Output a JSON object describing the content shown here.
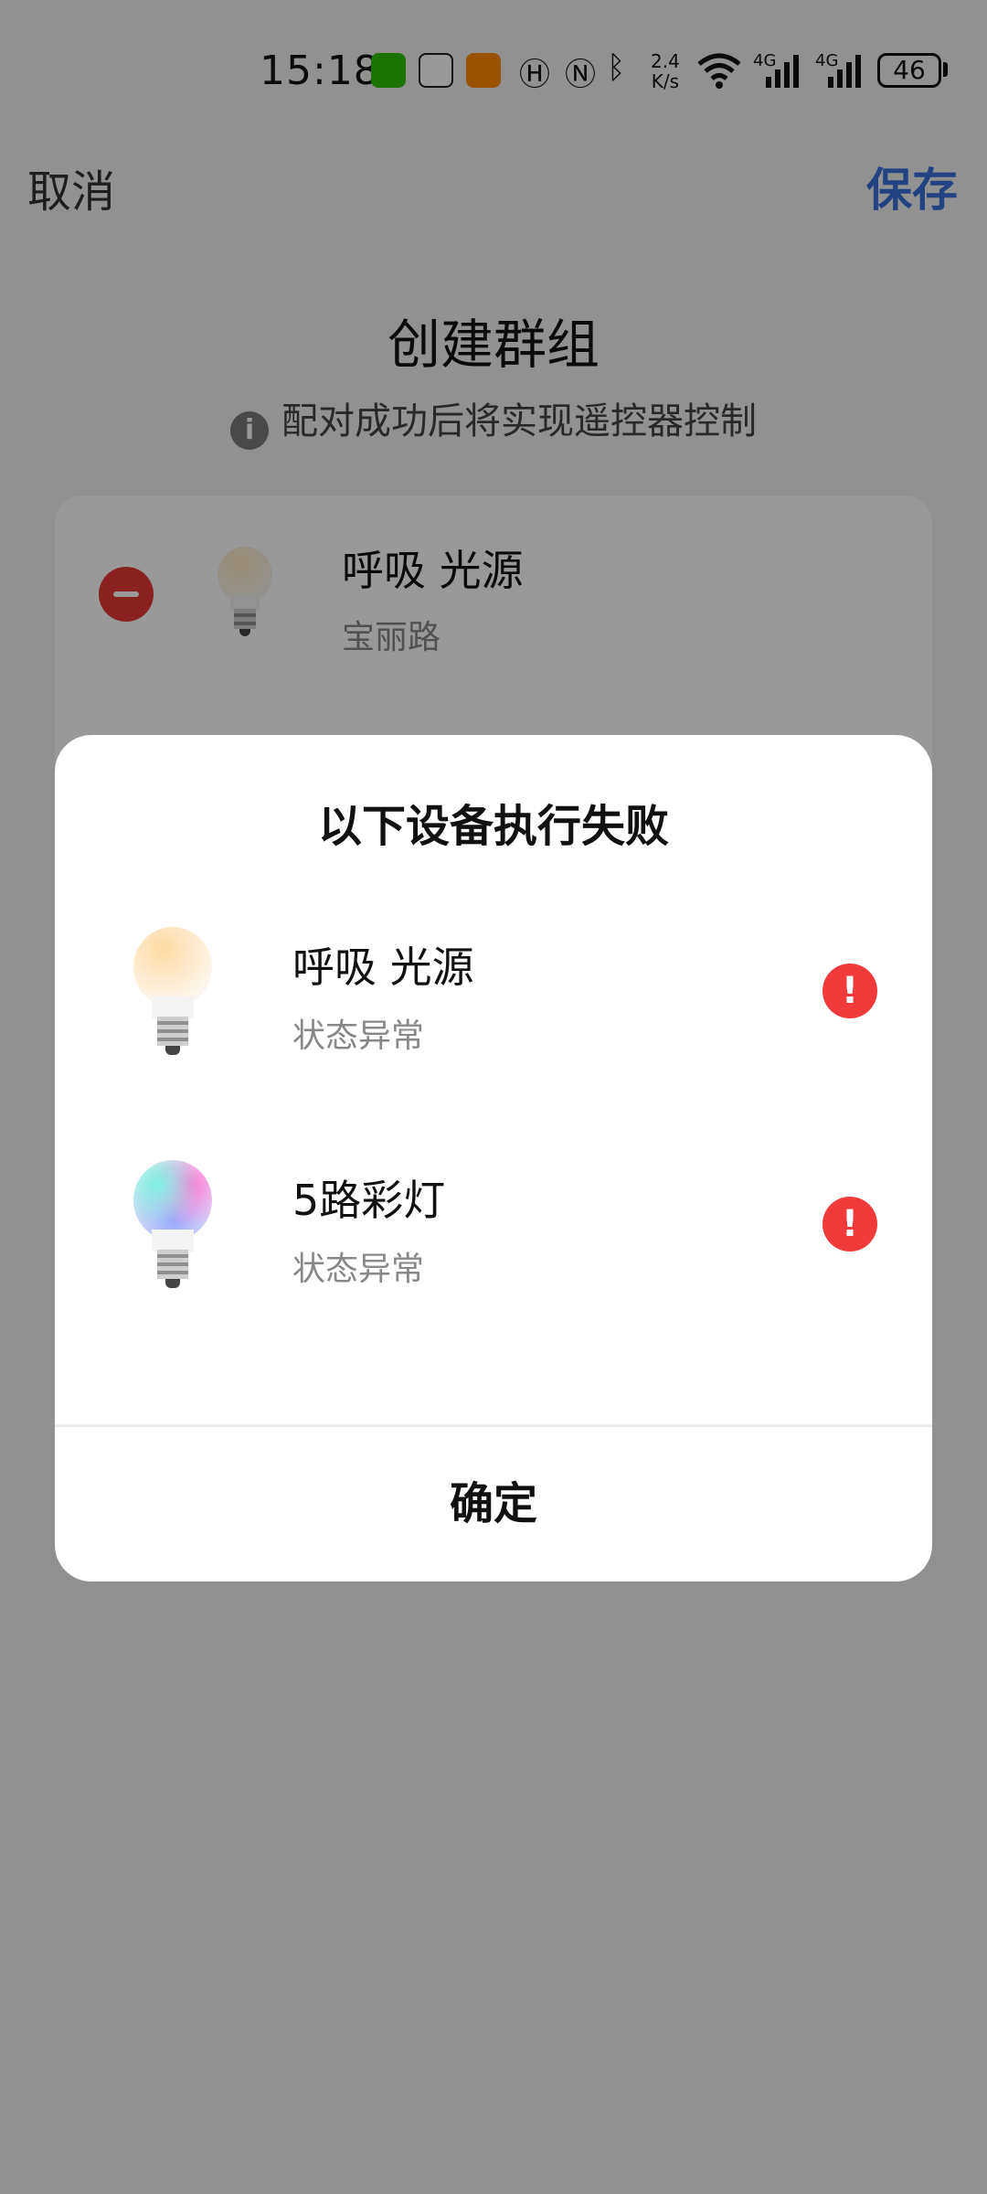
{
  "status_bar": {
    "time": "15:18",
    "net_speed_top": "2.4",
    "net_speed_bottom": "K/s",
    "signal1": "4G",
    "signal2": "4G",
    "battery": "46",
    "icons": [
      "wechat-icon",
      "qq-icon",
      "video-app-icon",
      "hd-icon",
      "nfc-icon",
      "bluetooth-icon",
      "wifi-icon",
      "signal-icon",
      "battery-icon"
    ]
  },
  "header": {
    "cancel_label": "取消",
    "save_label": "保存",
    "save_color": "#3a6fd8"
  },
  "page": {
    "title": "创建群组",
    "hint": "配对成功后将实现遥控器控制",
    "info_icon": "i"
  },
  "group_list": [
    {
      "name": "呼吸 光源",
      "room": "宝丽路"
    }
  ],
  "dialog": {
    "title": "以下设备执行失败",
    "items": [
      {
        "name": "呼吸 光源",
        "status": "状态异常",
        "icon": "warm-bulb-icon"
      },
      {
        "name": "5路彩灯",
        "status": "状态异常",
        "icon": "rgb-bulb-icon"
      }
    ],
    "alert_symbol": "!",
    "alert_color": "#f23a3a",
    "confirm_label": "确定"
  }
}
